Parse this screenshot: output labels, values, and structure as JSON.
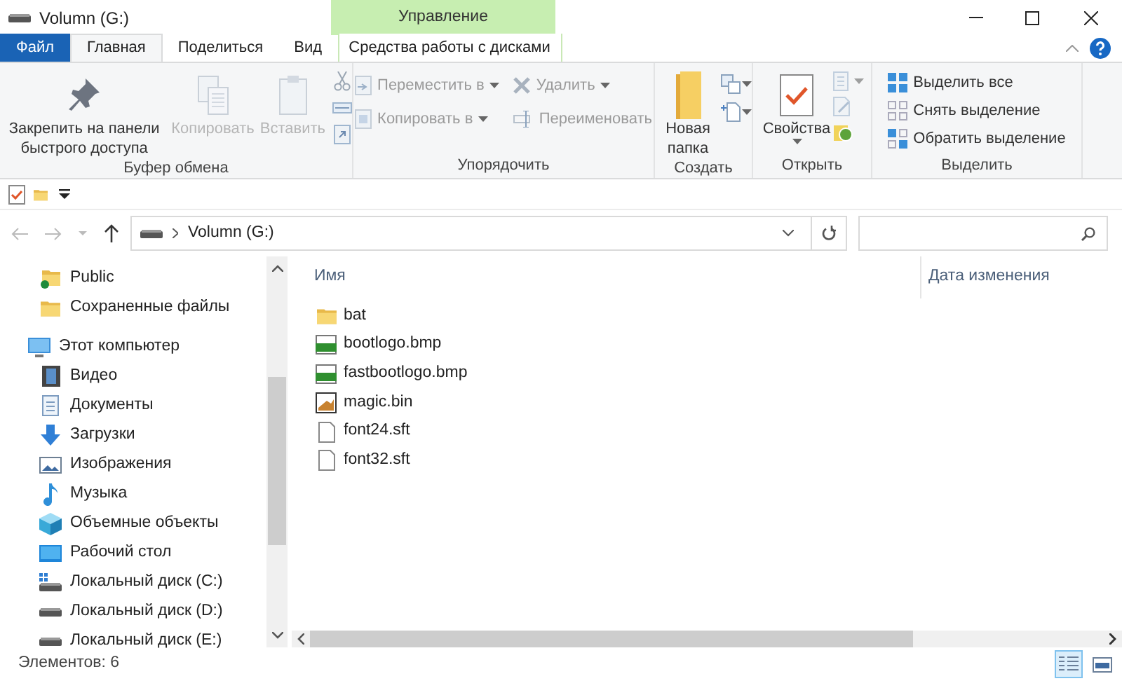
{
  "window": {
    "title": "Volumn (G:)"
  },
  "context_header": "Управление",
  "tabs": [
    {
      "label": "Файл",
      "kind": "file",
      "selected": false
    },
    {
      "label": "Главная",
      "kind": "normal",
      "selected": true
    },
    {
      "label": "Поделиться",
      "kind": "normal",
      "selected": false
    },
    {
      "label": "Вид",
      "kind": "normal",
      "selected": false
    },
    {
      "label": "Средства работы с дисками",
      "kind": "context",
      "selected": false
    }
  ],
  "ribbon": {
    "groups": [
      {
        "label": "Буфер обмена",
        "items": [
          {
            "label": "Закрепить на панели быстрого доступа",
            "kind": "large",
            "disabled": false,
            "dropdown": false
          },
          {
            "label": "Копировать",
            "kind": "large",
            "disabled": true,
            "dropdown": false
          },
          {
            "label": "Вставить",
            "kind": "large",
            "disabled": true,
            "dropdown": false
          }
        ]
      },
      {
        "label": "Упорядочить",
        "items": [
          {
            "label": "Переместить в",
            "kind": "small",
            "disabled": true,
            "dropdown": true
          },
          {
            "label": "Копировать в",
            "kind": "small",
            "disabled": true,
            "dropdown": true
          },
          {
            "label": "Удалить",
            "kind": "small",
            "disabled": true,
            "dropdown": true
          },
          {
            "label": "Переименовать",
            "kind": "small",
            "disabled": true,
            "dropdown": false
          }
        ]
      },
      {
        "label": "Создать",
        "items": [
          {
            "label": "Новая папка",
            "kind": "large",
            "disabled": false,
            "dropdown": false
          }
        ]
      },
      {
        "label": "Открыть",
        "items": [
          {
            "label": "Свойства",
            "kind": "large",
            "disabled": false,
            "dropdown": true
          }
        ]
      },
      {
        "label": "Выделить",
        "items": [
          {
            "label": "Выделить все",
            "kind": "small",
            "disabled": false,
            "dropdown": false
          },
          {
            "label": "Снять выделение",
            "kind": "small",
            "disabled": false,
            "dropdown": false
          },
          {
            "label": "Обратить выделение",
            "kind": "small",
            "disabled": false,
            "dropdown": false
          }
        ]
      }
    ]
  },
  "address": {
    "path": "Volumn (G:)"
  },
  "sidebar": {
    "items": [
      {
        "label": "Public",
        "kind": "shared-folder"
      },
      {
        "label": "Сохраненные файлы",
        "kind": "folder"
      },
      {
        "label": "Этот компьютер",
        "kind": "computer",
        "children": [
          {
            "label": "Видео",
            "kind": "video"
          },
          {
            "label": "Документы",
            "kind": "documents"
          },
          {
            "label": "Загрузки",
            "kind": "downloads"
          },
          {
            "label": "Изображения",
            "kind": "pictures"
          },
          {
            "label": "Музыка",
            "kind": "music"
          },
          {
            "label": "Объемные объекты",
            "kind": "objects"
          },
          {
            "label": "Рабочий стол",
            "kind": "desktop"
          },
          {
            "label": "Локальный диск (C:)",
            "kind": "system-drive"
          },
          {
            "label": "Локальный диск (D:)",
            "kind": "drive"
          },
          {
            "label": "Локальный диск (E:)",
            "kind": "drive"
          }
        ]
      }
    ]
  },
  "columns": [
    "Имя",
    "Дата изменения"
  ],
  "files": [
    {
      "name": "bat",
      "kind": "folder"
    },
    {
      "name": "bootlogo.bmp",
      "kind": "image"
    },
    {
      "name": "fastbootlogo.bmp",
      "kind": "image"
    },
    {
      "name": "magic.bin",
      "kind": "binary"
    },
    {
      "name": "font24.sft",
      "kind": "file"
    },
    {
      "name": "font32.sft",
      "kind": "file"
    }
  ],
  "status_bar": {
    "count": "Элементов: 6"
  },
  "views": [
    {
      "kind": "details",
      "selected": true
    },
    {
      "kind": "tiles",
      "selected": false
    }
  ]
}
